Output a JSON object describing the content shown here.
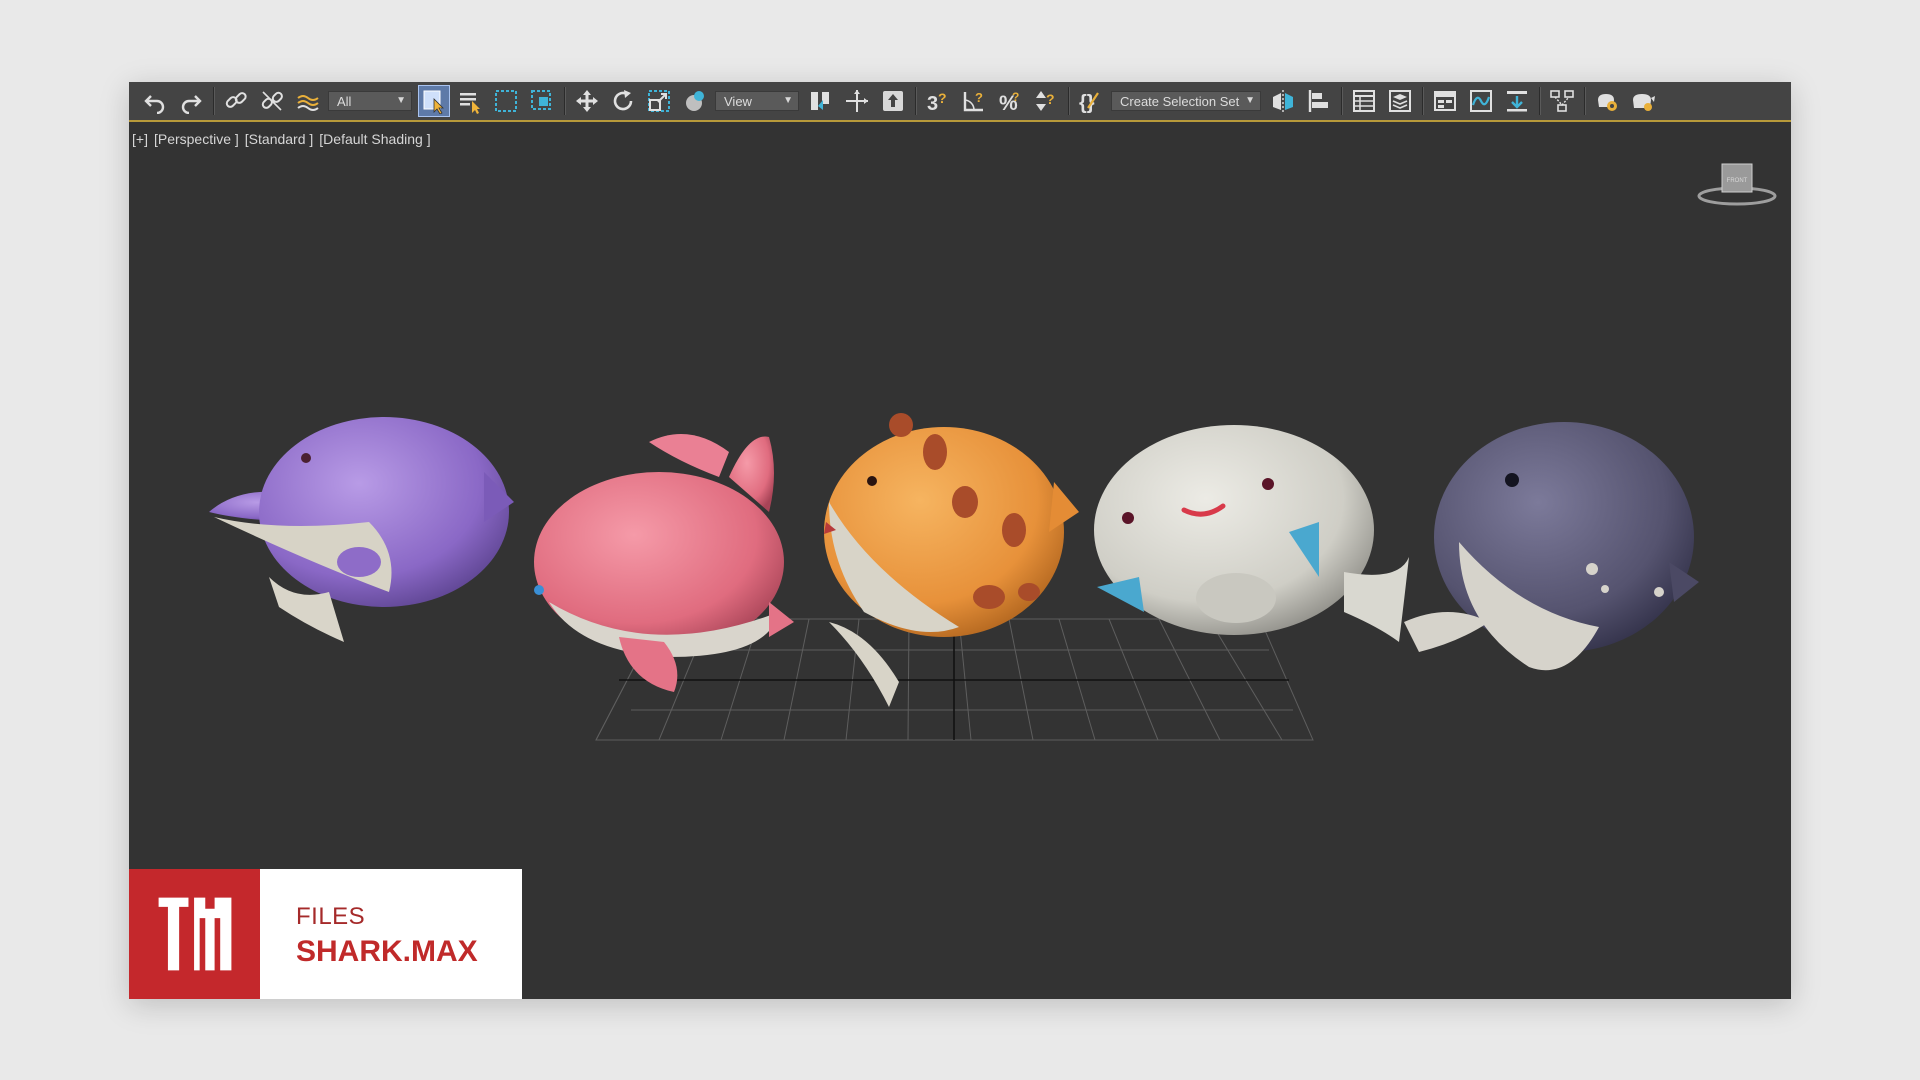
{
  "toolbar": {
    "selection_filter": "All",
    "coordinate_system": "View",
    "named_selection": "Create Selection Set"
  },
  "viewport": {
    "label_plus": "[+]",
    "label_view": "[Perspective ]",
    "label_style": "[Standard ]",
    "label_shading": "[Default Shading ]",
    "viewcube_face": "FRONT"
  },
  "brand": {
    "kicker": "FILES",
    "title": "SHARK.MAX"
  },
  "icons": {
    "undo": "undo-icon",
    "redo": "redo-icon",
    "link": "link-icon",
    "unlink": "unlink-icon",
    "bind": "bind-spacewarp-icon",
    "select": "select-object-icon",
    "select_by_name": "select-by-name-icon",
    "region": "rectangular-region-icon",
    "window": "window-crossing-icon",
    "move": "move-icon",
    "rotate": "rotate-icon",
    "scale": "scale-icon",
    "placement": "placement-icon",
    "pivot": "pivot-icon",
    "manipulate": "manipulate-icon",
    "keyboard": "keyboard-shortcut-icon",
    "snap": "snap-3d-icon",
    "angle_snap": "angle-snap-icon",
    "percent_snap": "percent-snap-icon",
    "spinner_snap": "spinner-snap-icon",
    "edit_named": "edit-named-selection-icon",
    "mirror": "mirror-icon",
    "align": "align-icon",
    "scene_explorer": "scene-explorer-icon",
    "layer": "layer-explorer-icon",
    "ribbon": "ribbon-icon",
    "curve": "curve-editor-icon",
    "schematic": "schematic-view-icon",
    "material": "material-editor-icon",
    "render_setup": "render-setup-icon",
    "render": "render-icon"
  }
}
